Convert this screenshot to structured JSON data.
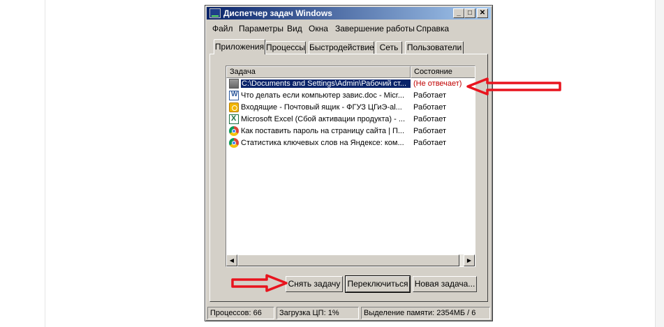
{
  "window": {
    "title": "Диспетчер задач Windows",
    "controls": {
      "minimize": "_",
      "maximize": "□",
      "close": "✕"
    }
  },
  "menu": [
    "Файл",
    "Параметры",
    "Вид",
    "Окна",
    "Завершение работы",
    "Справка"
  ],
  "tabs": [
    "Приложения",
    "Процессы",
    "Быстродействие",
    "Сеть",
    "Пользователи"
  ],
  "active_tab": "Приложения",
  "table": {
    "columns": [
      "Задача",
      "Состояние"
    ],
    "rows": [
      {
        "task": "C:\\Documents and Settings\\Admin\\Рабочий ст...",
        "state": "(Не отвечает)",
        "icon": "generic-app-icon",
        "selected": true
      },
      {
        "task": "Что делать если компьютер завис.doc - Micr...",
        "state": "Работает",
        "icon": "word-icon"
      },
      {
        "task": "Входящие - Почтовый ящик - ФГУЗ ЦГиЭ-al...",
        "state": "Работает",
        "icon": "outlook-icon"
      },
      {
        "task": "Microsoft Excel (Сбой активации продукта) - ...",
        "state": "Работает",
        "icon": "excel-icon"
      },
      {
        "task": "Как поставить пароль на страницу сайта | П...",
        "state": "Работает",
        "icon": "chrome-icon"
      },
      {
        "task": "Статистика ключевых слов на Яндексе: ком...",
        "state": "Работает",
        "icon": "chrome-icon"
      }
    ]
  },
  "buttons": {
    "end_task": "Снять задачу",
    "switch_to": "Переключиться",
    "new_task": "Новая задача..."
  },
  "status": {
    "processes": "Процессов: 66",
    "cpu": "Загрузка ЦП: 1%",
    "memory": "Выделение памяти: 2354МБ / 6"
  },
  "colors": {
    "titlebar_start": "#0a246a",
    "titlebar_end": "#a6caf0",
    "selection": "#0a246a",
    "not_responding": "#c00000",
    "annotation_arrow": "#e8141e"
  }
}
